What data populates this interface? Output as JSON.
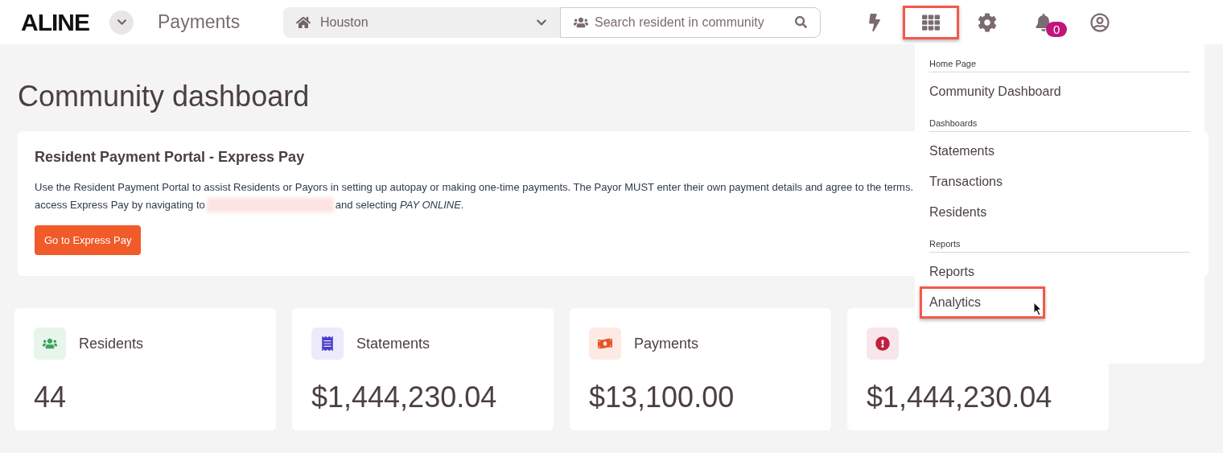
{
  "header": {
    "logo": "ALINE",
    "app_title": "Payments",
    "community_select": {
      "value": "Houston"
    },
    "search": {
      "placeholder": "Search resident in community"
    },
    "notifications_count": "0",
    "apps_button": {
      "highlighted": true
    }
  },
  "page_title": "Community dashboard",
  "portal": {
    "title": "Resident Payment Portal - Express Pay",
    "line_1": "Use the Resident Payment Portal to assist Residents or Payors in setting up autopay or making one-time payments. The Payor MUST enter their own payment details and agree to the terms.",
    "line_2_before": "access Express Pay by navigating to",
    "line_2_after": "and selecting *PAY ONLINE*.",
    "button": "Go to Express Pay"
  },
  "stats": [
    {
      "kind": "residents",
      "label": "Residents",
      "value": "44"
    },
    {
      "kind": "statements",
      "label": "Statements",
      "value": "$1,444,230.04"
    },
    {
      "kind": "payments",
      "label": "Payments",
      "value": "$13,100.00"
    },
    {
      "kind": "alert",
      "value": "$1,444,230.04"
    }
  ],
  "menu": {
    "sections": [
      {
        "heading": "Home Page",
        "items": [
          {
            "label": "Community Dashboard",
            "highlighted": false
          }
        ]
      },
      {
        "heading": "Dashboards",
        "items": [
          {
            "label": "Statements",
            "highlighted": false
          },
          {
            "label": "Transactions",
            "highlighted": false
          },
          {
            "label": "Residents",
            "highlighted": false
          }
        ]
      },
      {
        "heading": "Reports",
        "items": [
          {
            "label": "Reports",
            "highlighted": false
          },
          {
            "label": "Analytics",
            "highlighted": true
          }
        ]
      }
    ]
  }
}
